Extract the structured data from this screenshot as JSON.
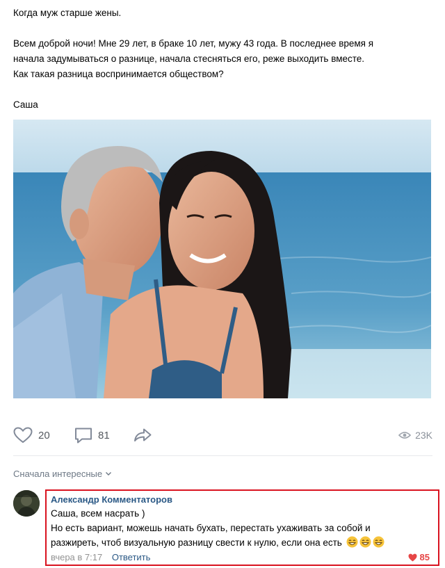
{
  "post": {
    "title": "Когда муж старше жены.",
    "paragraph_1": "Всем доброй ночи! Мне 29 лет, в браке 10 лет, мужу 43 года. В последнее время я",
    "paragraph_2": "начала задумываться о разнице, начала стесняться его, реже выходить вместе.",
    "paragraph_3": "Как такая разница воспринимается обществом?",
    "signature": "Саша"
  },
  "actions": {
    "likes": "20",
    "comments": "81",
    "views": "23K",
    "icons": [
      "heart-icon",
      "comment-icon",
      "share-icon",
      "eye-icon"
    ]
  },
  "comments_section": {
    "sort_label": "Сначала интересные"
  },
  "comment": {
    "author": "Александр Комментаторов",
    "line_1": "Саша, всем насрать )",
    "line_2": "Но есть вариант, можешь начать бухать, перестать ухаживать за собой и",
    "line_3": "разжиреть, чтоб визуальную разницу свести к нулю, если она есть",
    "time": "вчера в 7:17",
    "reply_label": "Ответить",
    "likes": "85",
    "emoji_count": 3
  },
  "colors": {
    "link": "#2a5885",
    "muted": "#939393",
    "highlight_border": "#d9121f",
    "like_red": "#e64646"
  }
}
